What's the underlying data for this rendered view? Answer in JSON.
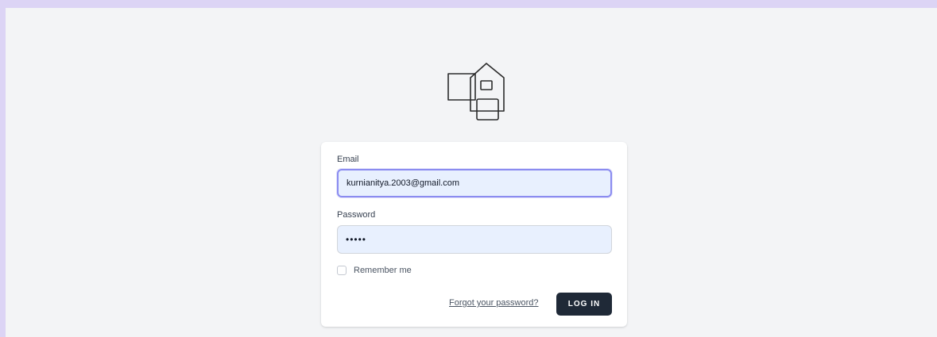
{
  "logo": {
    "icon": "house-logo-icon"
  },
  "form": {
    "email_label": "Email",
    "email_value": "kurnianitya.2003@gmail.com",
    "password_label": "Password",
    "password_value": "•••••",
    "remember_label": "Remember me",
    "remember_checked": false,
    "forgot_link": "Forgot your password?",
    "login_button": "LOG IN"
  },
  "colors": {
    "page_border": "#dcd4f5",
    "page_background": "#f3f4f6",
    "input_background": "#e8f0fe",
    "focus_ring": "#8b8cf0",
    "button_background": "#1f2937"
  }
}
